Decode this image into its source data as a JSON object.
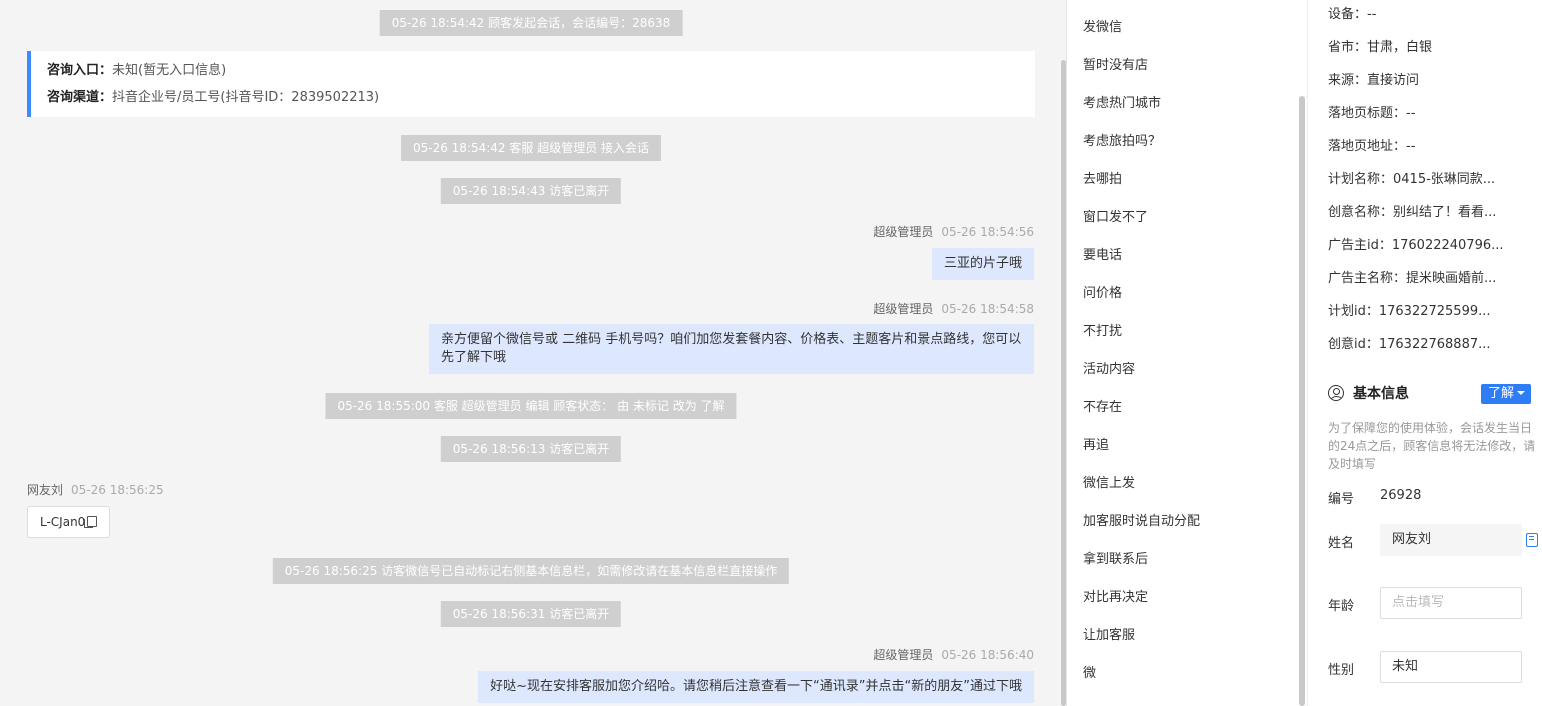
{
  "chat": {
    "system_messages": [
      "05-26 18:54:42 顾客发起会话，会话编号：28638",
      "05-26 18:54:42 客服 超级管理员 接入会话",
      "05-26 18:54:43 访客已离开",
      "05-26 18:55:00 客服 超级管理员 编辑 顾客状态： 由 未标记 改为 了解",
      "05-26 18:56:13 访客已离开",
      "05-26 18:56:25 访客微信号已自动标记右侧基本信息栏，如需修改请在基本信息栏直接操作",
      "05-26 18:56:31 访客已离开"
    ],
    "info_card": {
      "entry_label": "咨询入口：",
      "entry_value": "未知(暂无入口信息)",
      "channel_label": "咨询渠道：",
      "channel_value": "抖音企业号/员工号(抖音号ID：2839502213)"
    },
    "messages": [
      {
        "sender": "超级管理员",
        "time": "05-26 18:54:56",
        "text": "三亚的片子哦"
      },
      {
        "sender": "超级管理员",
        "time": "05-26 18:54:58",
        "text": "亲方便留个微信号或 二维码 手机号吗？咱们加您发套餐内容、价格表、主题客片和景点路线，您可以先了解下哦"
      },
      {
        "sender": "网友刘",
        "time": "05-26 18:56:25",
        "text": "L-CJan0"
      },
      {
        "sender": "超级管理员",
        "time": "05-26 18:56:40",
        "text": "好哒~现在安排客服加您介绍哈。请您稍后注意查看一下“通讯录”并点击“新的朋友”通过下哦"
      }
    ]
  },
  "quick_replies": [
    "发微信",
    "暂时没有店",
    "考虑热门城市",
    "考虑旅拍吗？",
    "去哪拍",
    "窗口发不了",
    "要电话",
    "问价格",
    "不打扰",
    "活动内容",
    "不存在",
    "再追",
    "微信上发",
    "加客服时说自动分配",
    "拿到联系后",
    "对比再决定",
    "让加客服",
    "微"
  ],
  "panel": {
    "device": "设备：--",
    "region": "省市：甘肃，白银",
    "source": "来源：直接访问",
    "landing_title": "落地页标题：--",
    "landing_url": "落地页地址：--",
    "plan_name": "计划名称：0415-张琳同款...",
    "creative_name": "创意名称：别纠结了！看看...",
    "advertiser_id": "广告主id：176022240796...",
    "advertiser_name": "广告主名称：提米映画婚前...",
    "plan_id": "计划id：176322725599...",
    "creative_id": "创意id：176322768887...",
    "basic_title": "基本信息",
    "learn_label": "了解",
    "notice": "为了保障您的使用体验，会话发生当日的24点之后，顾客信息将无法修改，请及时填写",
    "id_label": "编号",
    "id_value": "26928",
    "name_label": "姓名",
    "name_value": "网友刘",
    "age_label": "年龄",
    "age_placeholder": "点击填写",
    "gender_label": "性别",
    "gender_value": "未知"
  }
}
